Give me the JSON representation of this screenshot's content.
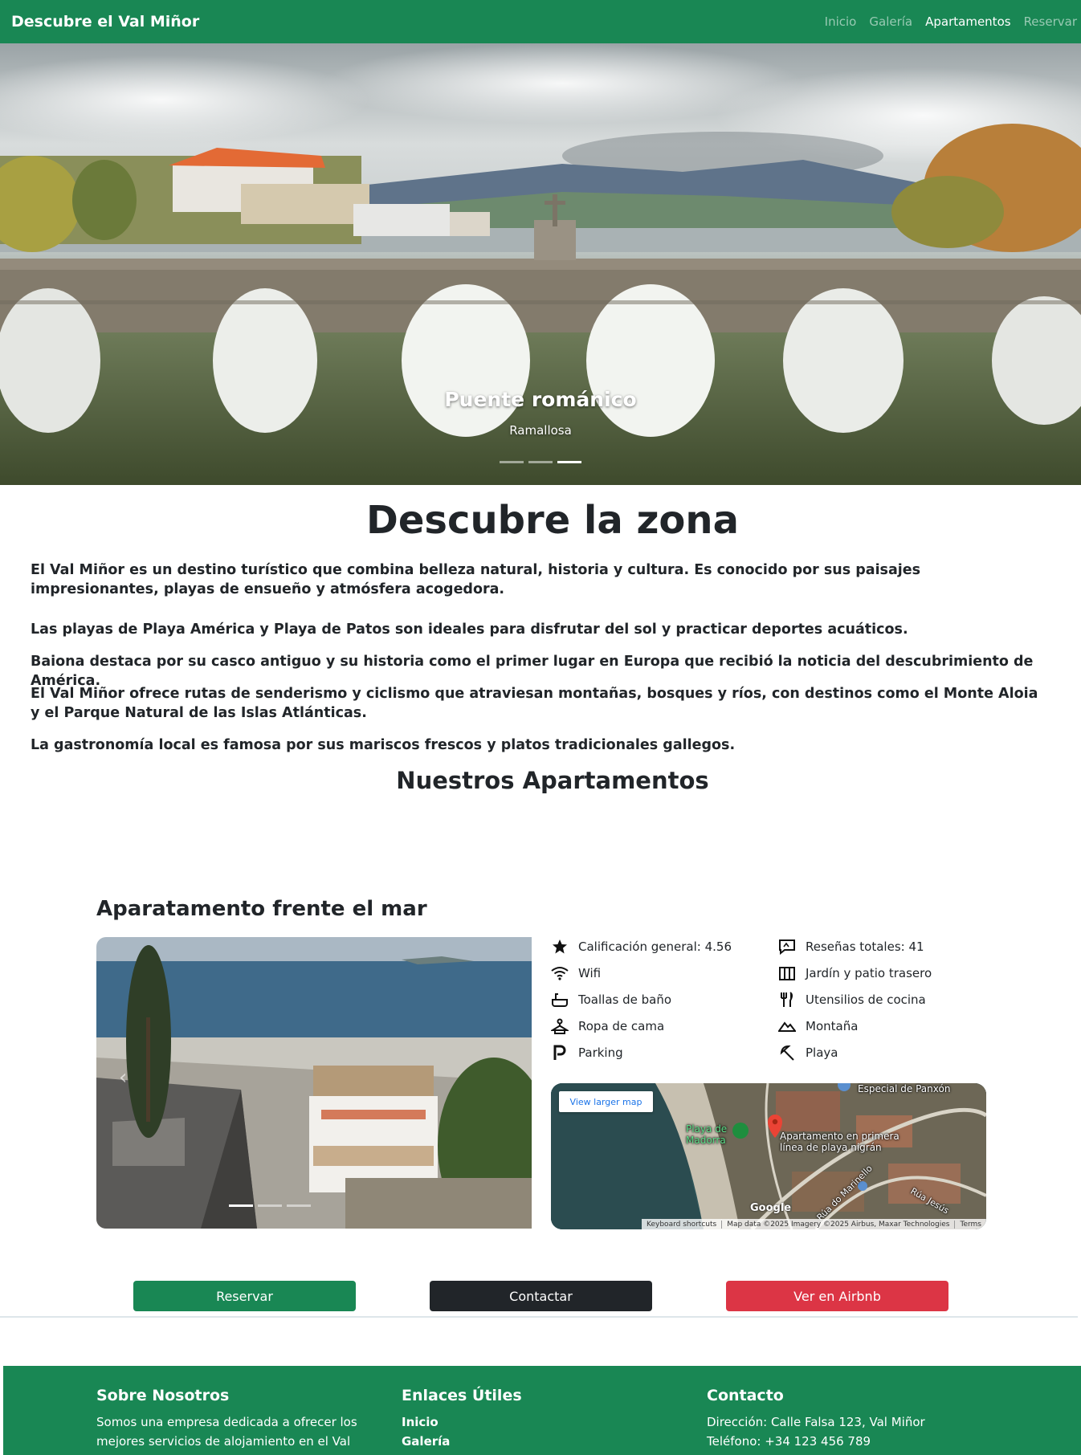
{
  "navbar": {
    "brand": "Descubre el Val Miñor",
    "links": [
      "Inicio",
      "Galería",
      "Apartamentos",
      "Reservar"
    ],
    "active_index": 2
  },
  "hero": {
    "caption_title": "Puente románico",
    "caption_subtitle": "Ramallosa",
    "slides": 3,
    "active_slide": 2
  },
  "about": {
    "title": "Descubre la zona",
    "intro": "El Val Miñor es un destino turístico que combina belleza natural, historia y cultura. Es conocido por sus paisajes impresionantes, playas de ensueño y atmósfera acogedora.",
    "paragraphs": [
      "Las playas de Playa América y Playa de Patos son ideales para disfrutar del sol y practicar deportes acuáticos.",
      "Baiona destaca por su casco antiguo y su historia como el primer lugar en Europa que recibió la noticia del descubrimiento de América.",
      "El Val Miñor ofrece rutas de senderismo y ciclismo que atraviesan montañas, bosques y ríos, con destinos como el Monte Aloia y el Parque Natural de las Islas Atlánticas.",
      "La gastronomía local es famosa por sus mariscos frescos y platos tradicionales gallegos."
    ]
  },
  "apartments": {
    "title": "Nuestros Apartamentos",
    "apartment": {
      "name": "Aparatamento frente el mar",
      "amenities": [
        {
          "icon": "star-icon",
          "label": "Calificación general: 4.56"
        },
        {
          "icon": "review-icon",
          "label": "Reseñas totales: 41"
        },
        {
          "icon": "wifi-icon",
          "label": "Wifi"
        },
        {
          "icon": "garden-icon",
          "label": "Jardín y patio trasero"
        },
        {
          "icon": "bath-icon",
          "label": "Toallas de baño"
        },
        {
          "icon": "utensils-icon",
          "label": "Utensilios de cocina"
        },
        {
          "icon": "hanger-icon",
          "label": "Ropa de cama"
        },
        {
          "icon": "mountain-icon",
          "label": "Montaña"
        },
        {
          "icon": "parking-icon",
          "label": "Parking"
        },
        {
          "icon": "beach-umbrella-icon",
          "label": "Playa"
        }
      ],
      "map": {
        "larger_map": "View larger map",
        "place_top": "Especial de Panxón",
        "beach": "Playa de Madorra",
        "marker_label": "Apartamento en primera línea de playa nigrán",
        "street1": "Rúa do Marinello",
        "street2": "Rúa Jesús",
        "google": "Google",
        "footer": [
          "Keyboard shortcuts",
          "Map data ©2025 Imagery ©2025 Airbus, Maxar Technologies",
          "Terms"
        ]
      }
    },
    "buttons": {
      "reserve": "Reservar",
      "contact": "Contactar",
      "airbnb": "Ver en Airbnb"
    }
  },
  "footer": {
    "about_title": "Sobre Nosotros",
    "about_text": "Somos una empresa dedicada a ofrecer los mejores servicios de alojamiento en el Val Miñor.",
    "links_title": "Enlaces Útiles",
    "links": [
      "Inicio",
      "Galería"
    ],
    "contact_title": "Contacto",
    "address": "Dirección: Calle Falsa 123, Val Miñor",
    "phone": "Teléfono: +34 123 456 789"
  },
  "colors": {
    "primary": "#198754",
    "dark": "#212529",
    "danger": "#dc3545"
  }
}
